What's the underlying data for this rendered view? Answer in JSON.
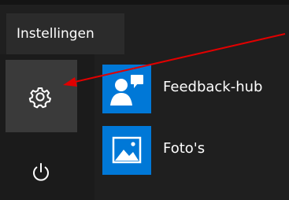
{
  "settings_tooltip": {
    "label": "Instellingen"
  },
  "rail": {
    "settings_button": {
      "icon": "gear-icon"
    },
    "power_button": {
      "icon": "power-icon"
    }
  },
  "apps": [
    {
      "label": "Feedback-hub",
      "icon": "feedback-hub-icon"
    },
    {
      "label": "Foto's",
      "icon": "photos-icon"
    }
  ],
  "colors": {
    "background": "#1f1f1f",
    "rail": "#1b1b1b",
    "tooltip": "#2b2b2b",
    "settings_highlight": "#3a3a3a",
    "tile_accent": "#0078d7",
    "annotation_arrow": "#e00000"
  }
}
